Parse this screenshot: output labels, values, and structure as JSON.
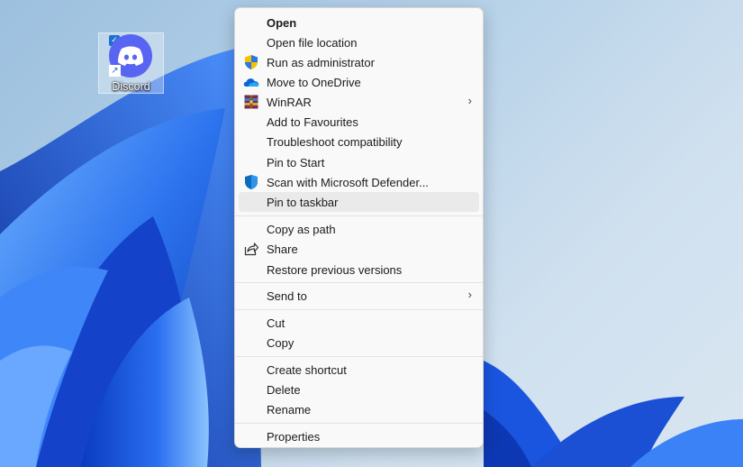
{
  "desktop": {
    "icon_label": "Discord",
    "icon_name": "discord-icon"
  },
  "context_menu": {
    "items": [
      {
        "label": "Open",
        "icon": null
      },
      {
        "label": "Open file location",
        "icon": null
      },
      {
        "label": "Run as administrator",
        "icon": "uac-shield-icon"
      },
      {
        "label": "Move to OneDrive",
        "icon": "onedrive-cloud-icon"
      },
      {
        "label": "WinRAR",
        "icon": "winrar-icon",
        "submenu": true
      },
      {
        "label": "Add to Favourites",
        "icon": null
      },
      {
        "label": "Troubleshoot compatibility",
        "icon": null
      },
      {
        "label": "Pin to Start",
        "icon": null
      },
      {
        "label": "Scan with Microsoft Defender...",
        "icon": "defender-shield-icon"
      },
      {
        "label": "Pin to taskbar",
        "icon": null,
        "highlighted": true
      },
      {
        "label": "Copy as path",
        "icon": null
      },
      {
        "label": "Share",
        "icon": "share-icon"
      },
      {
        "label": "Restore previous versions",
        "icon": null
      },
      {
        "label": "Send to",
        "icon": null,
        "submenu": true
      },
      {
        "label": "Cut",
        "icon": null
      },
      {
        "label": "Copy",
        "icon": null
      },
      {
        "label": "Create shortcut",
        "icon": null
      },
      {
        "label": "Delete",
        "icon": null
      },
      {
        "label": "Rename",
        "icon": null
      },
      {
        "label": "Properties",
        "icon": null
      }
    ]
  },
  "colors": {
    "menu_background": "#f9f9f9",
    "hover_background": "#eaeaea",
    "wallpaper_blue": "#1f5fe0"
  }
}
